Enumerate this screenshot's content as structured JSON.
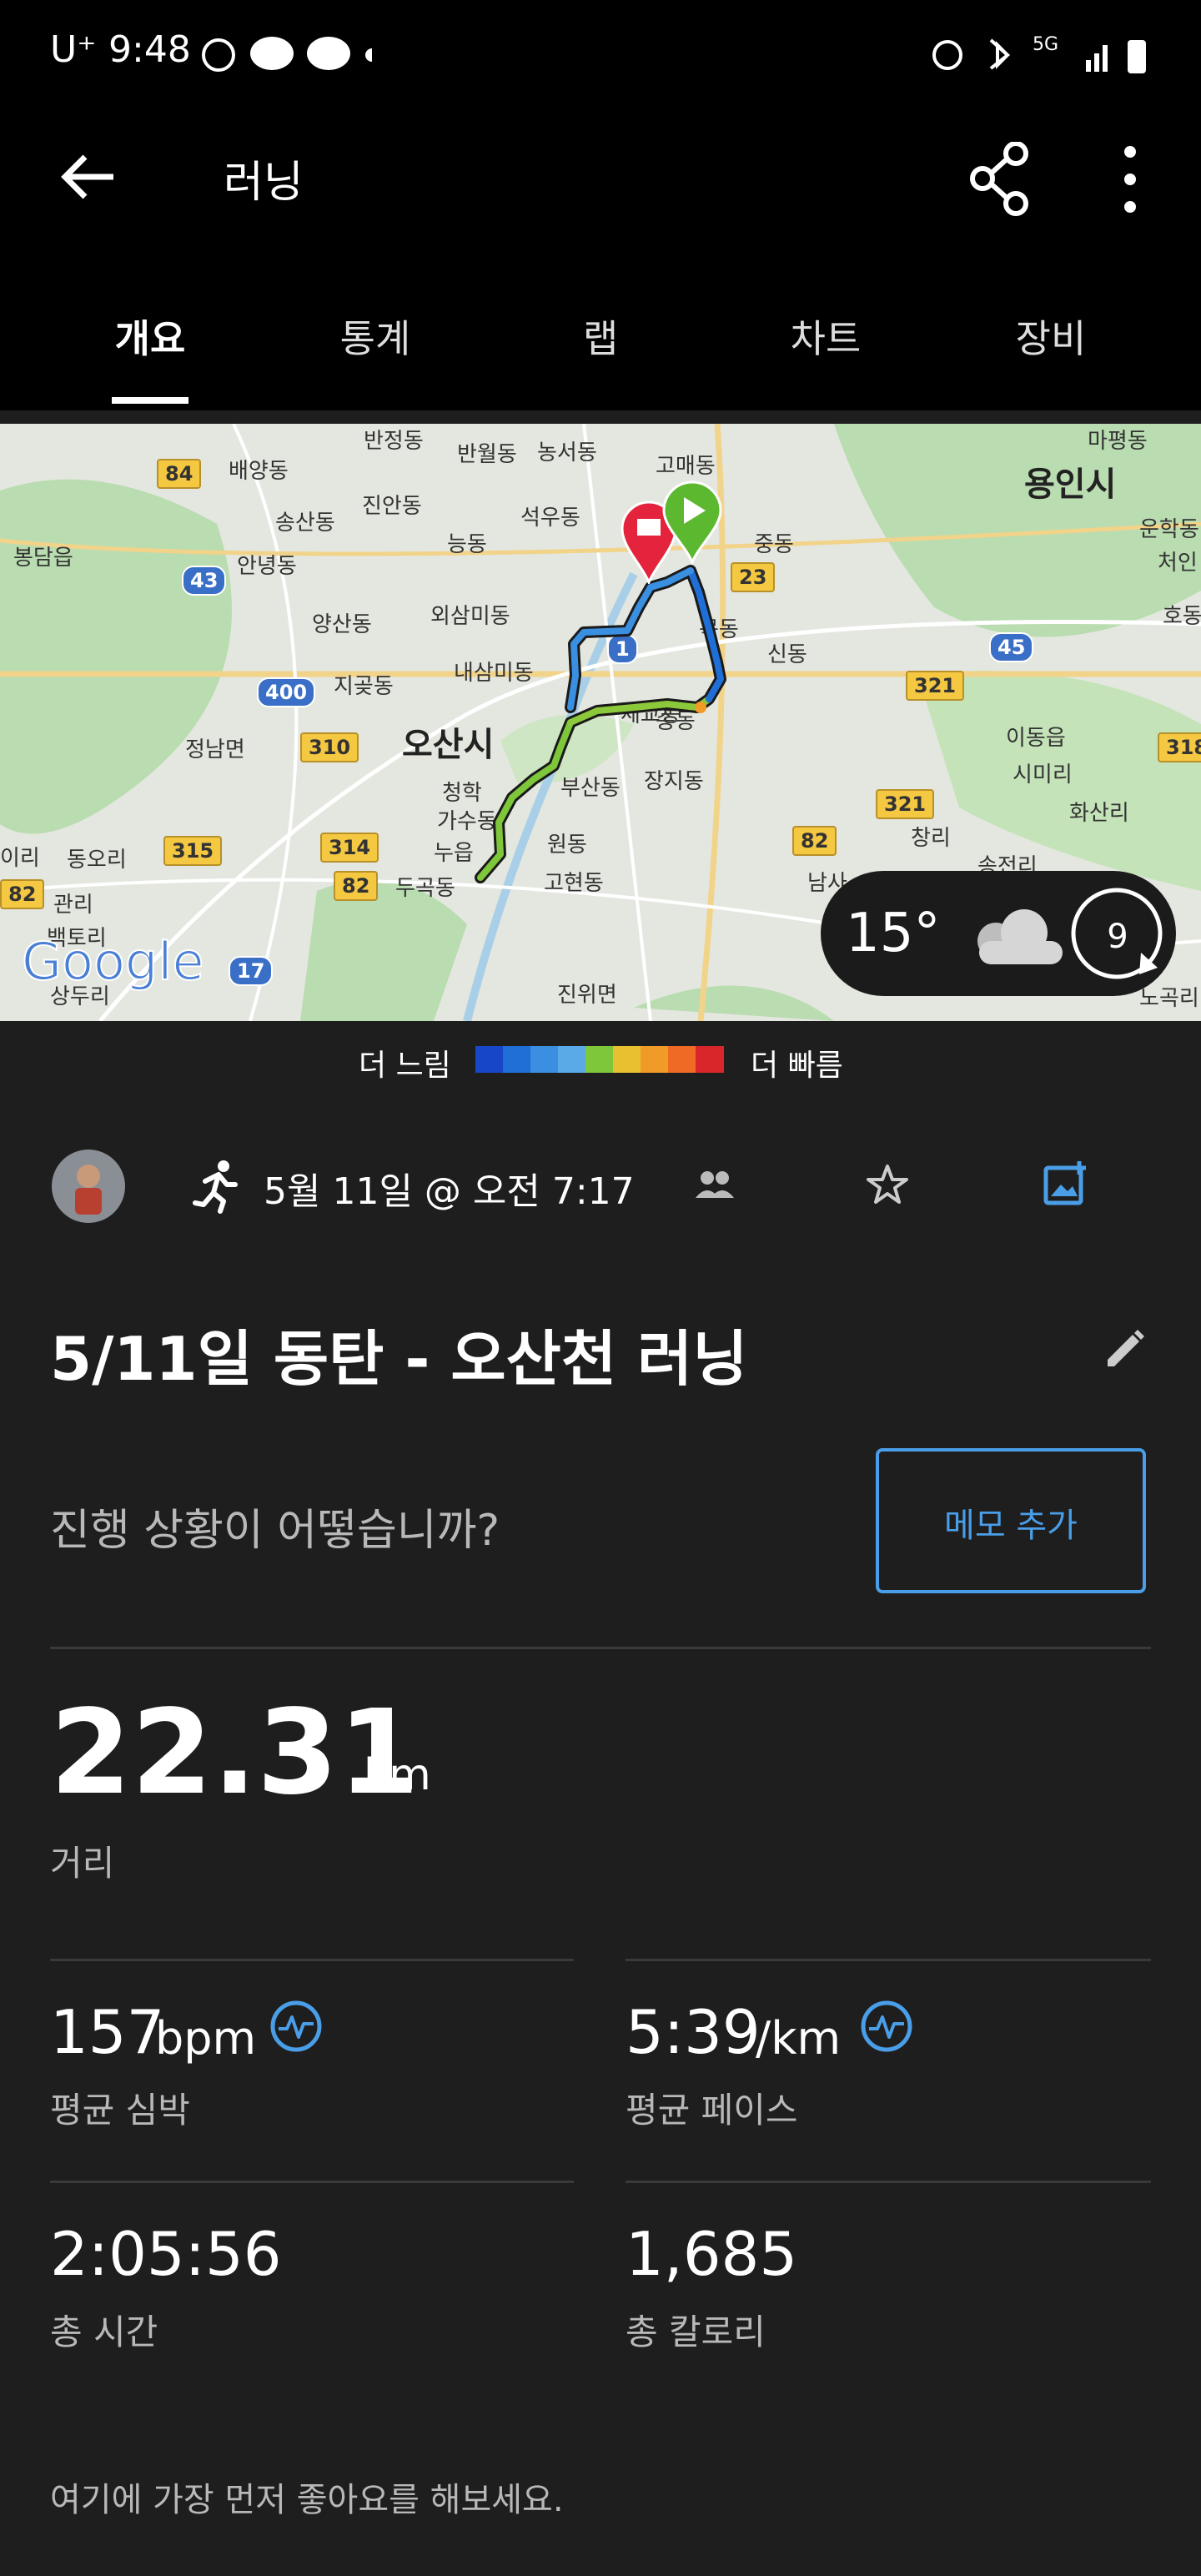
{
  "status_bar": {
    "carrier": "U⁺",
    "time": "9:48",
    "net": "5G"
  },
  "app_bar": {
    "title": "러닝"
  },
  "tabs": [
    {
      "label": "개요"
    },
    {
      "label": "통계"
    },
    {
      "label": "랩"
    },
    {
      "label": "차트"
    },
    {
      "label": "장비"
    }
  ],
  "map": {
    "city_labels": [
      "오산시",
      "용인시"
    ],
    "place_labels": [
      "반정동",
      "반월동",
      "농서동",
      "고매동",
      "마평동",
      "배양동",
      "진안동",
      "석우동",
      "송산동",
      "능동",
      "중동",
      "운학동",
      "봉담읍",
      "안녕동",
      "처인",
      "양산동",
      "외삼미동",
      "호동",
      "내삼미동",
      "신동",
      "지곶동",
      "정남면",
      "이동읍",
      "시미리",
      "부산동",
      "장지동",
      "화산리",
      "청학",
      "가수동",
      "누읍",
      "원동",
      "이리",
      "동오리",
      "고현동",
      "창리",
      "두곡동",
      "관리",
      "백토리",
      "상두리",
      "진위면",
      "세교동",
      "송동",
      "목동",
      "남사",
      "송전리",
      "노곡리"
    ],
    "road_shields": [
      "84",
      "43",
      "400",
      "310",
      "315",
      "314",
      "82",
      "17",
      "23",
      "321",
      "45",
      "318",
      "321",
      "82",
      "82",
      "1"
    ],
    "google_logo": "Google"
  },
  "weather": {
    "temperature": "15°",
    "wind_speed": "9"
  },
  "legend": {
    "slow_label": "더 느림",
    "fast_label": "더 빠름",
    "colors": [
      "#1846c8",
      "#1f6fd6",
      "#3a8fe0",
      "#5aaae8",
      "#7ec63a",
      "#e8c030",
      "#f09a28",
      "#ef6a24",
      "#d8262a"
    ]
  },
  "activity": {
    "date": "5월 11일 @ 오전 7:17",
    "title": "5/11일 동탄 - 오산천 러닝",
    "prompt": "진행 상황이 어떻습니까?",
    "memo_button": "메모 추가"
  },
  "stats": {
    "distance": {
      "value": "22.31",
      "unit": "km",
      "label": "거리"
    },
    "heart_rate": {
      "value": "157",
      "unit": "bpm",
      "label": "평균 심박"
    },
    "pace": {
      "value": "5:39",
      "unit": "/km",
      "label": "평균 페이스"
    },
    "time": {
      "value": "2:05:56",
      "label": "총 시간"
    },
    "calories": {
      "value": "1,685",
      "label": "총 칼로리"
    }
  },
  "footer": {
    "like_prompt": "여기에 가장 먼저 좋아요를 해보세요."
  },
  "colors": {
    "accent": "#4a9ee8",
    "background": "#1e1e1e",
    "start_pin": "#5cb82e",
    "end_pin": "#e3243c"
  }
}
